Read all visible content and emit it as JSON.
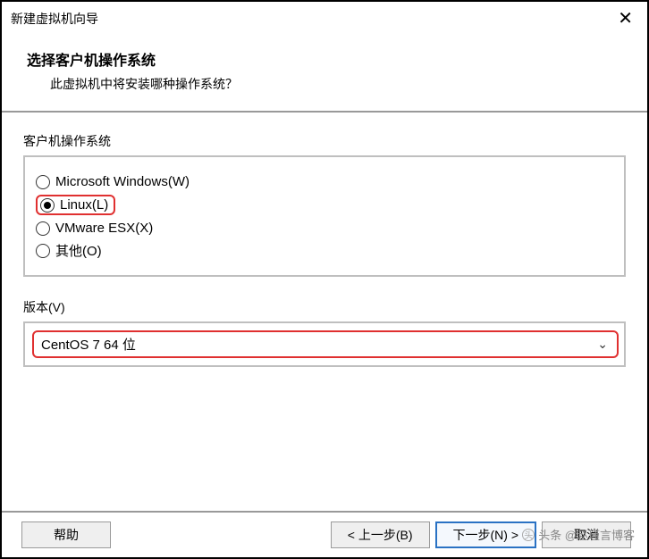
{
  "titlebar": {
    "title": "新建虚拟机向导"
  },
  "header": {
    "title": "选择客户机操作系统",
    "subtitle": "此虚拟机中将安装哪种操作系统？"
  },
  "os_group": {
    "label": "客户机操作系统",
    "options": {
      "windows": "Microsoft Windows(W)",
      "linux": "Linux(L)",
      "vmware": "VMware ESX(X)",
      "other": "其他(O)"
    },
    "selected": "linux"
  },
  "version": {
    "label": "版本(V)",
    "selected": "CentOS 7 64 位"
  },
  "buttons": {
    "help": "帮助",
    "back": "< 上一步(B)",
    "next": "下一步(N) >",
    "cancel": "取消"
  },
  "watermark": "头条 @赵瑾言博客"
}
